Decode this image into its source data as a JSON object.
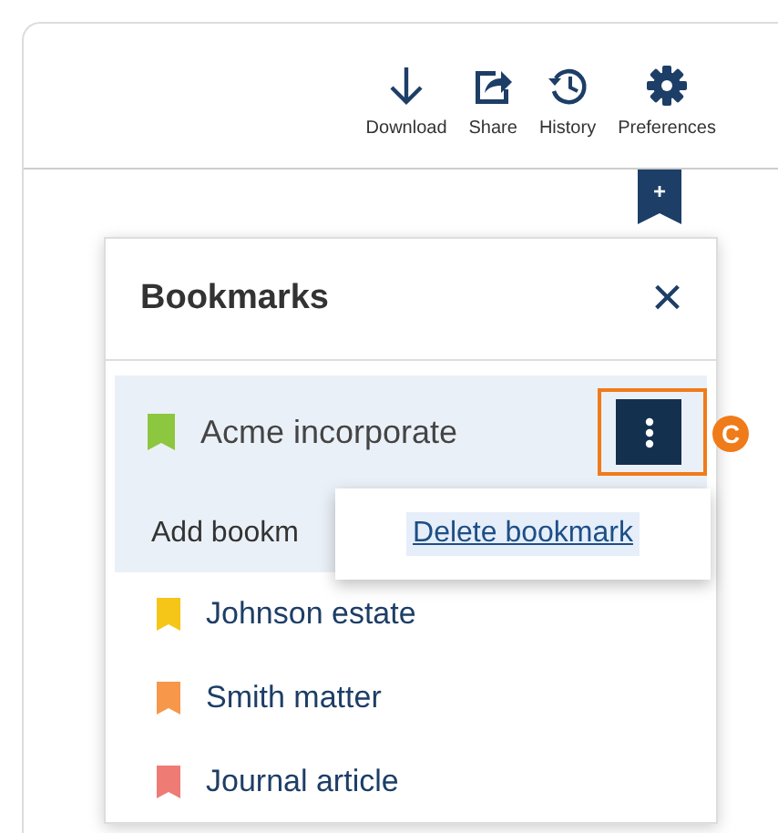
{
  "toolbar": [
    {
      "kind": "download",
      "label": "Download"
    },
    {
      "kind": "share",
      "label": "Share"
    },
    {
      "kind": "history",
      "label": "History"
    },
    {
      "kind": "preferences",
      "label": "Preferences"
    }
  ],
  "ribbon_tab": {
    "label": "+"
  },
  "panel": {
    "title": "Bookmarks",
    "close": "×",
    "current": {
      "name": "Acme incorporate",
      "color": "#8dc63f",
      "selected": true,
      "menu_open": true,
      "menu": [
        "Delete bookmark"
      ],
      "callout": "C"
    },
    "add_label": "Add bookm",
    "items": [
      {
        "name": "Johnson estate",
        "color": "#f5c518"
      },
      {
        "name": "Smith matter",
        "color": "#f7974a"
      },
      {
        "name": "Journal article",
        "color": "#ee7b74"
      }
    ]
  }
}
